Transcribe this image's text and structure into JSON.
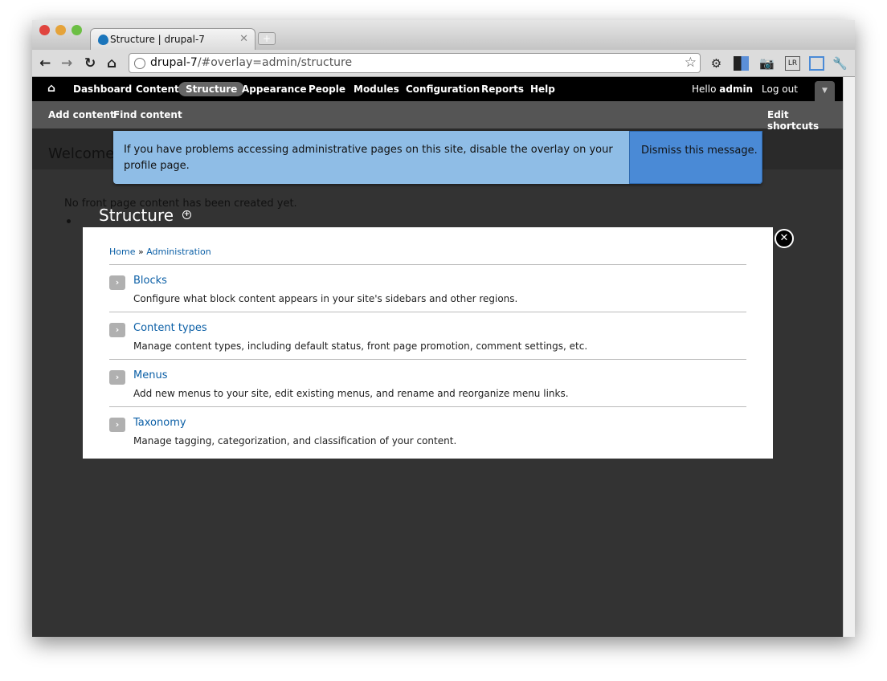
{
  "browser": {
    "tab_title": "Structure | drupal-7",
    "url_host": "drupal-7",
    "url_path": "/#overlay=admin/structure"
  },
  "admin_menu": {
    "items": [
      "Dashboard",
      "Content",
      "Structure",
      "Appearance",
      "People",
      "Modules",
      "Configuration",
      "Reports",
      "Help"
    ],
    "active": "Structure",
    "greeting": "Hello",
    "user": "admin",
    "logout": "Log out"
  },
  "shortcuts": {
    "items": [
      "Add content",
      "Find content"
    ],
    "edit": "Edit shortcuts"
  },
  "page": {
    "welcome": "Welcome",
    "front_text": "No front page content has been created yet."
  },
  "message": {
    "text": "If you have problems accessing administrative pages on this site, disable the overlay on your profile page.",
    "dismiss": "Dismiss this message."
  },
  "overlay": {
    "title": "Structure",
    "breadcrumb": [
      "Home",
      "Administration"
    ],
    "sep": "»",
    "items": [
      {
        "title": "Blocks",
        "desc": "Configure what block content appears in your site's sidebars and other regions."
      },
      {
        "title": "Content types",
        "desc": "Manage content types, including default status, front page promotion, comment settings, etc."
      },
      {
        "title": "Menus",
        "desc": "Add new menus to your site, edit existing menus, and rename and reorganize menu links."
      },
      {
        "title": "Taxonomy",
        "desc": "Manage tagging, categorization, and classification of your content."
      }
    ]
  }
}
